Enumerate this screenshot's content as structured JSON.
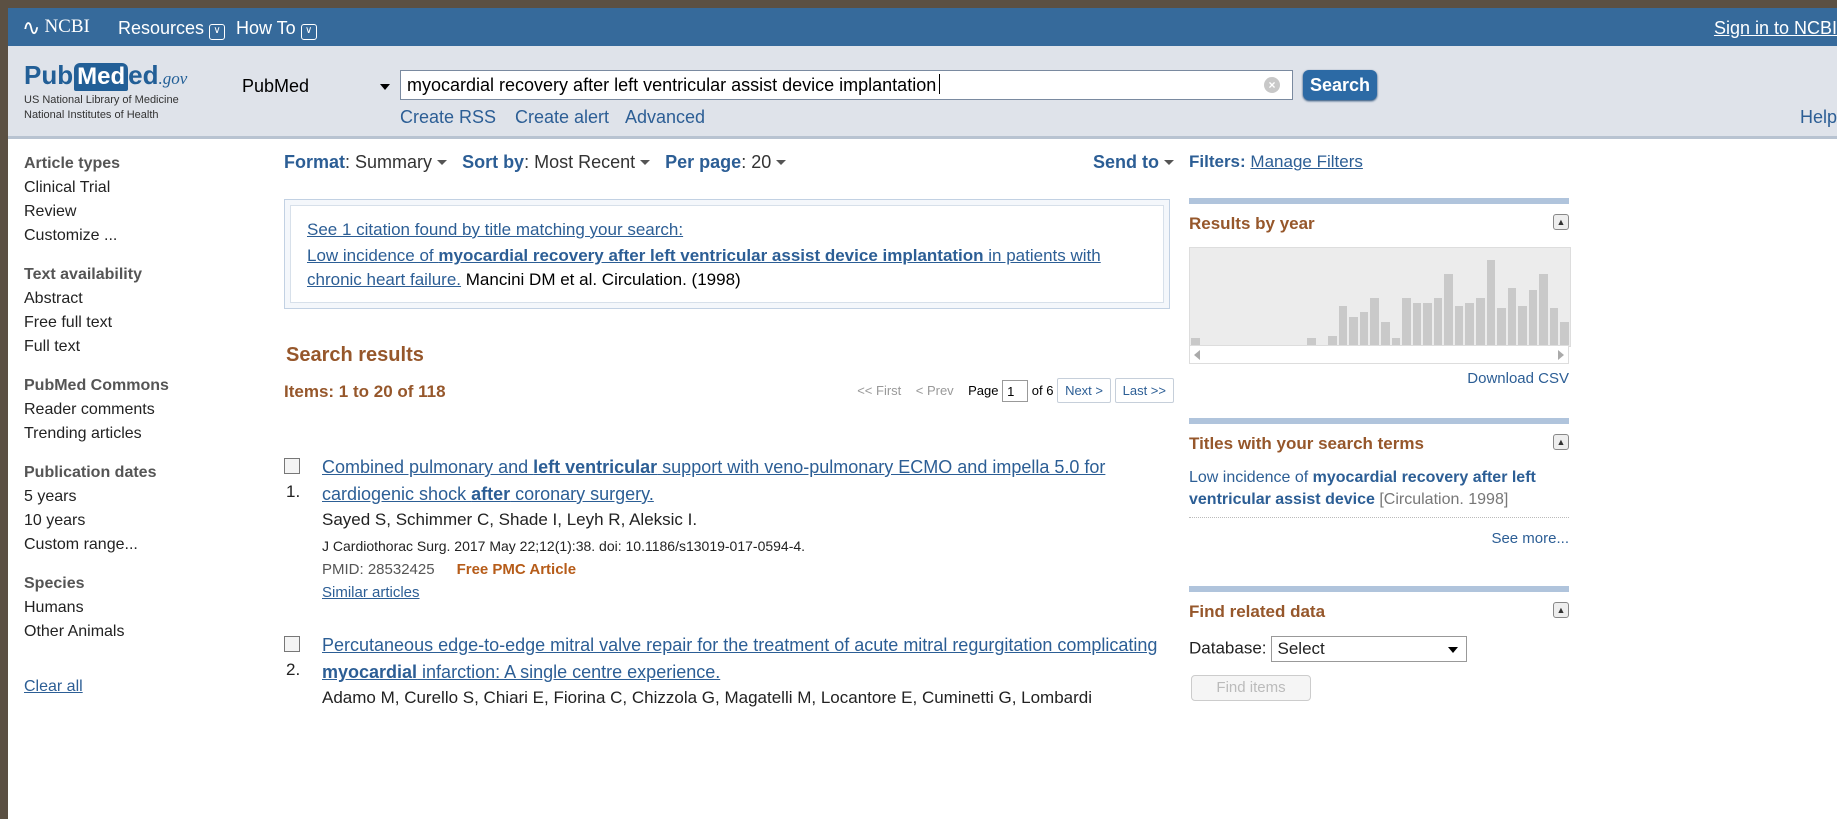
{
  "topbar": {
    "brand": "NCBI",
    "menus": [
      "Resources",
      "How To"
    ],
    "signin": "Sign in to NCBI"
  },
  "header": {
    "logo": {
      "pub": "Pub",
      "med": "Med",
      "ed": "ed",
      "gov": ".gov",
      "line1": "US National Library of Medicine",
      "line2": "National Institutes of Health"
    },
    "database": "PubMed",
    "query": "myocardial recovery after left ventricular assist device implantation",
    "search_label": "Search",
    "links": [
      "Create RSS",
      "Create alert",
      "Advanced"
    ],
    "help": "Help"
  },
  "sidebar": {
    "groups": [
      {
        "header": "Article types",
        "items": [
          "Clinical Trial",
          "Review",
          "Customize ..."
        ]
      },
      {
        "header": "Text availability",
        "items": [
          "Abstract",
          "Free full text",
          "Full text"
        ]
      },
      {
        "header": "PubMed Commons",
        "items": [
          "Reader comments",
          "Trending articles"
        ]
      },
      {
        "header": "Publication dates",
        "items": [
          "5 years",
          "10 years",
          "Custom range..."
        ]
      },
      {
        "header": "Species",
        "items": [
          "Humans",
          "Other Animals"
        ]
      }
    ],
    "clear_all": "Clear all"
  },
  "toolbar": {
    "format_label": "Format",
    "format_value": "Summary",
    "sort_label": "Sort by",
    "sort_value": "Most Recent",
    "perpage_label": "Per page",
    "perpage_value": "20",
    "send_to": "Send to"
  },
  "citation": {
    "link": "See 1 citation found by title matching your search:",
    "pre": "Low incidence of ",
    "bold": "myocardial recovery after left ventricular assist device implantation",
    "post": " in patients with chronic heart failure.",
    "source": " Mancini DM et al. Circulation. (1998)"
  },
  "results": {
    "heading": "Search results",
    "items_label": "Items: 1 to 20 of 118",
    "pager": {
      "first": "<< First",
      "prev": "< Prev",
      "page_label": "Page",
      "page": "1",
      "of": "of 6",
      "next": "Next >",
      "last": "Last >>"
    },
    "list": [
      {
        "num": "1.",
        "title_parts": [
          {
            "t": "Combined pulmonary and ",
            "b": false
          },
          {
            "t": "left ventricular",
            "b": true
          },
          {
            "t": " support with veno-pulmonary ECMO and impella 5.0 for cardiogenic shock ",
            "b": false
          },
          {
            "t": "after",
            "b": true
          },
          {
            "t": " coronary surgery.",
            "b": false
          }
        ],
        "authors": "Sayed S, Schimmer C, Shade I, Leyh R, Aleksic I.",
        "journal": "J Cardiothorac Surg. 2017 May 22;12(1):38. doi: 10.1186/s13019-017-0594-4.",
        "pmid": "PMID: 28532425",
        "free": "Free PMC Article",
        "similar": "Similar articles"
      },
      {
        "num": "2.",
        "title_parts": [
          {
            "t": "Percutaneous edge-to-edge mitral valve repair for the treatment of acute mitral regurgitation complicating ",
            "b": false
          },
          {
            "t": "myocardial",
            "b": true
          },
          {
            "t": " infarction: A single centre experience.",
            "b": false
          }
        ],
        "authors": "Adamo M, Curello S, Chiari E, Fiorina C, Chizzola G, Magatelli M, Locantore E, Cuminetti G, Lombardi",
        "journal": "",
        "pmid": "",
        "free": "",
        "similar": ""
      }
    ]
  },
  "right": {
    "filters_label": "Filters:",
    "manage_filters": "Manage Filters",
    "results_by_year": {
      "heading": "Results by year",
      "bar_levels": [
        0.08,
        0,
        0,
        0,
        0,
        0,
        0,
        0,
        0,
        0,
        0,
        0.08,
        0,
        0.1,
        0.42,
        0.3,
        0.35,
        0.5,
        0.25,
        0.08,
        0.5,
        0.45,
        0.45,
        0.5,
        0.75,
        0.42,
        0.45,
        0.5,
        0.9,
        0.4,
        0.6,
        0.42,
        0.58,
        0.75,
        0.4,
        0.25
      ],
      "download": "Download CSV"
    },
    "titles_panel": {
      "heading": "Titles with your search terms",
      "pre": "Low incidence of ",
      "bold": "myocardial recovery after left ventricular assist device",
      "cite": " [Circulation. 1998]",
      "see_more": "See more..."
    },
    "related": {
      "heading": "Find related data",
      "db_label": "Database:",
      "db_value": "Select",
      "find_items": "Find items"
    }
  }
}
